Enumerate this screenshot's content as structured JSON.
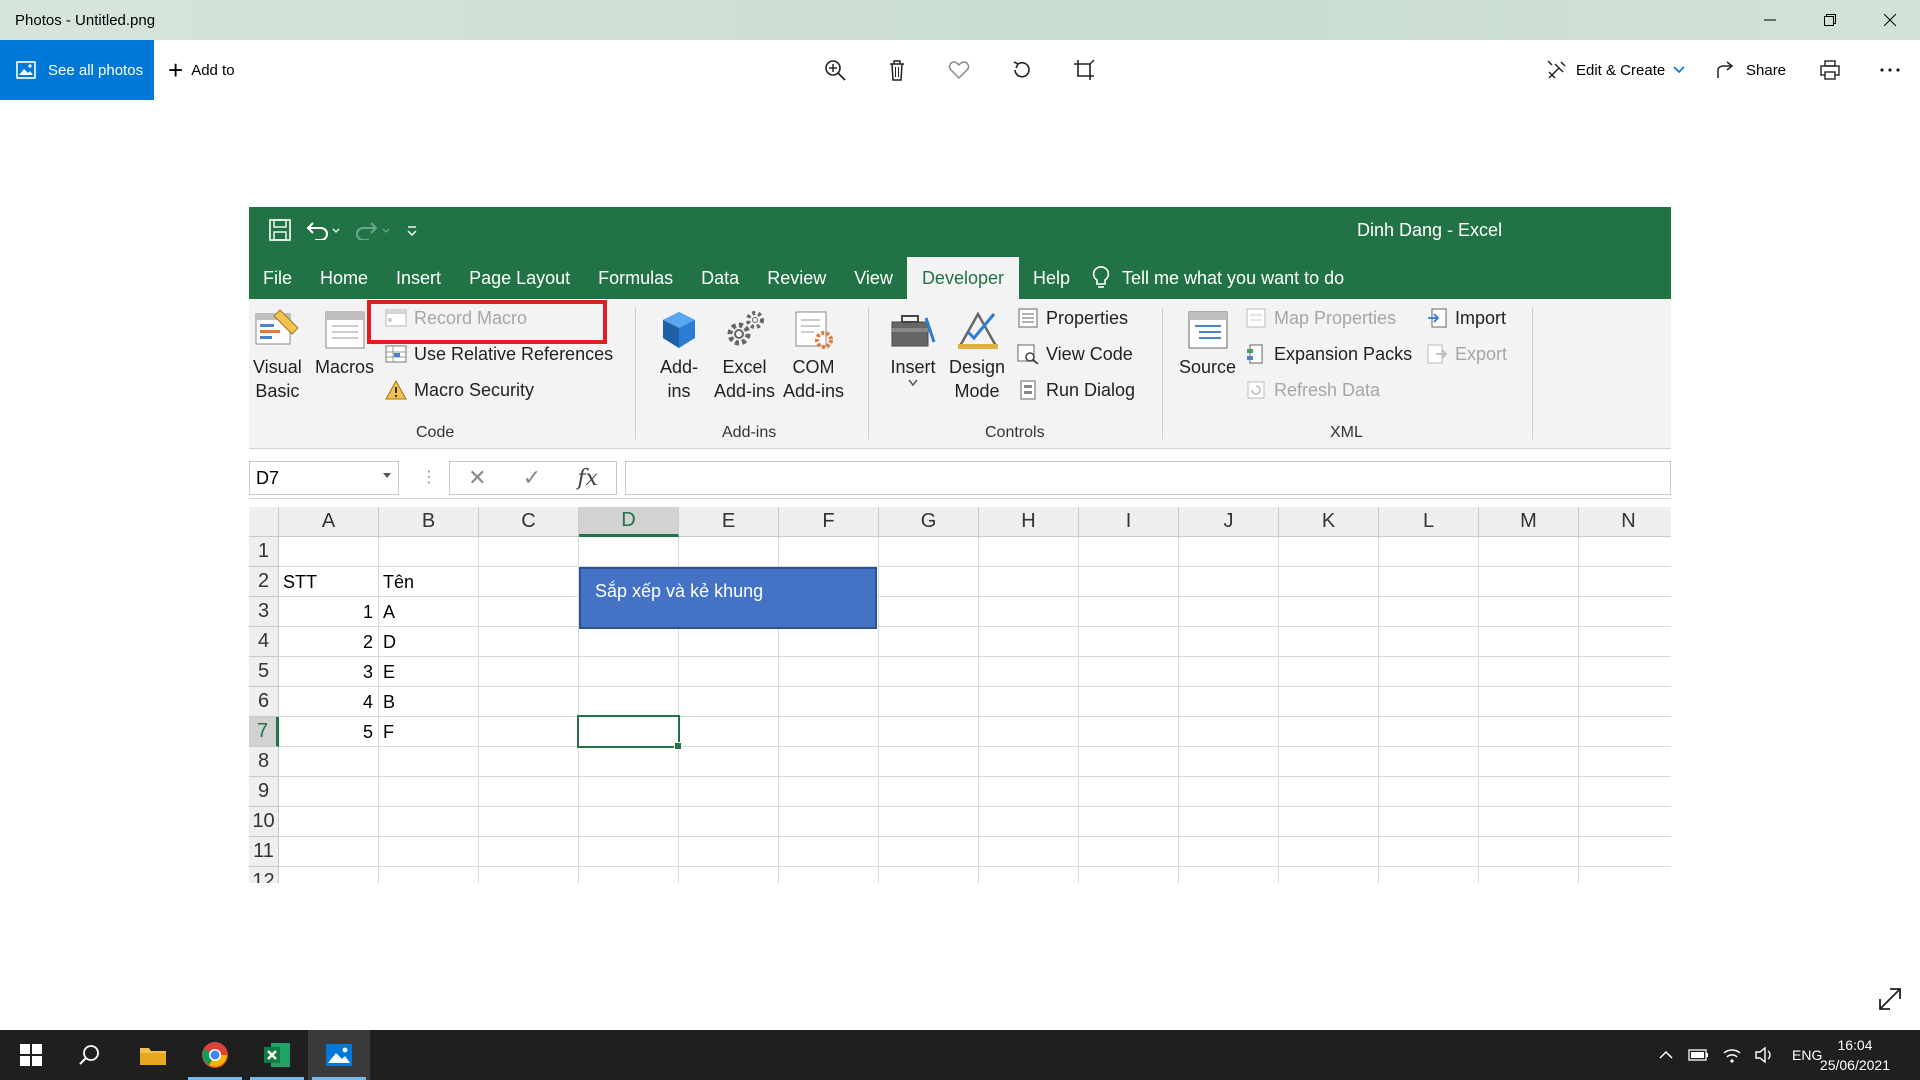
{
  "window": {
    "title": "Photos - Untitled.png"
  },
  "toolbar": {
    "see_all_label": "See all photos",
    "add_to_label": "Add to",
    "edit_create_label": "Edit & Create",
    "share_label": "Share"
  },
  "excel": {
    "title": "Dinh Dang  -  Excel",
    "tabs": [
      "File",
      "Home",
      "Insert",
      "Page Layout",
      "Formulas",
      "Data",
      "Review",
      "View",
      "Developer",
      "Help"
    ],
    "active_tab": "Developer",
    "tell_me": "Tell me what you want to do",
    "ribbon": {
      "code": {
        "label": "Code",
        "visual_basic": [
          "Visual",
          "Basic"
        ],
        "macros": "Macros",
        "record_macro": "Record Macro",
        "relative_refs": "Use Relative References",
        "macro_security": "Macro Security"
      },
      "addins": {
        "label": "Add-ins",
        "addins": [
          "Add-",
          "ins"
        ],
        "excel_addins": [
          "Excel",
          "Add-ins"
        ],
        "com_addins": [
          "COM",
          "Add-ins"
        ]
      },
      "controls": {
        "label": "Controls",
        "insert": "Insert",
        "design_mode": [
          "Design",
          "Mode"
        ],
        "properties": "Properties",
        "view_code": "View Code",
        "run_dialog": "Run Dialog"
      },
      "xml": {
        "label": "XML",
        "source": "Source",
        "map_properties": "Map Properties",
        "expansion_packs": "Expansion Packs",
        "refresh_data": "Refresh Data",
        "import": "Import",
        "export": "Export"
      }
    },
    "name_box": "D7",
    "fx_label": "fx",
    "columns": [
      "A",
      "B",
      "C",
      "D",
      "E",
      "F",
      "G",
      "H",
      "I",
      "J",
      "K",
      "L",
      "M",
      "N"
    ],
    "rows": [
      "1",
      "2",
      "3",
      "4",
      "5",
      "6",
      "7",
      "8",
      "9",
      "10",
      "11",
      "12"
    ],
    "selected_column": "D",
    "selected_row": "7",
    "cells": {
      "A2": "STT",
      "B2": "Tên",
      "A3": "1",
      "B3": "A",
      "A4": "2",
      "B4": "D",
      "A5": "3",
      "B5": "E",
      "A6": "4",
      "B6": "B",
      "A7": "5",
      "B7": "F"
    },
    "macro_button": "Sắp xếp và kẻ khung"
  },
  "taskbar": {
    "language": "ENG",
    "time": "16:04",
    "date": "25/06/2021"
  },
  "colors": {
    "excel_green": "#217346",
    "photos_blue": "#0078d7",
    "highlight_red": "#e31b23",
    "macro_button_fill": "#4472c4"
  }
}
